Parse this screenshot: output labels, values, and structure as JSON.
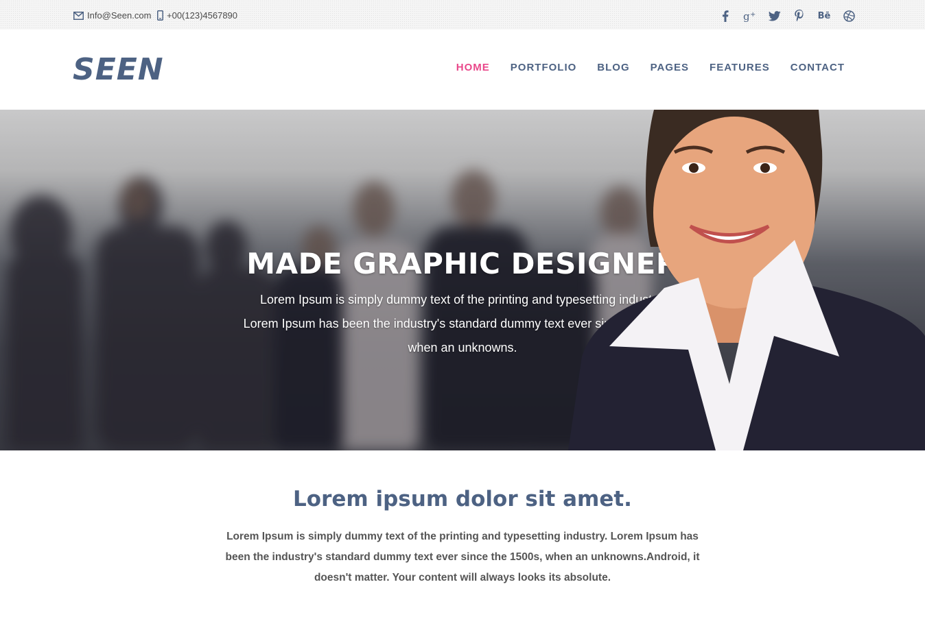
{
  "topbar": {
    "email": "Info@Seen.com",
    "phone": "+00(123)4567890",
    "social_icons": [
      "facebook-icon",
      "google-plus-icon",
      "twitter-icon",
      "pinterest-icon",
      "behance-icon",
      "dribbble-icon"
    ],
    "behance_label": "Bē"
  },
  "header": {
    "logo": "SEEN",
    "nav": [
      "HOME",
      "PORTFOLIO",
      "BLOG",
      "PAGES",
      "FEATURES",
      "CONTACT"
    ],
    "active_nav": "HOME"
  },
  "hero": {
    "title": "MADE GRAPHIC DESIGNER",
    "lines": [
      "Lorem Ipsum is simply dummy text of the printing and typesetting industry.",
      "Lorem Ipsum has been the industry's standard dummy text ever since the 1500s",
      "when an unknowns."
    ]
  },
  "intro": {
    "title": "Lorem ipsum dolor sit amet.",
    "text": "Lorem Ipsum is simply dummy text of the printing and typesetting industry. Lorem Ipsum has been the industry's standard dummy text ever since the 1500s, when an unknowns.Android, it doesn't matter. Your content will always looks its absolute."
  },
  "colors": {
    "brand": "#4d6283",
    "accent": "#e9478a",
    "text": "#555555"
  }
}
